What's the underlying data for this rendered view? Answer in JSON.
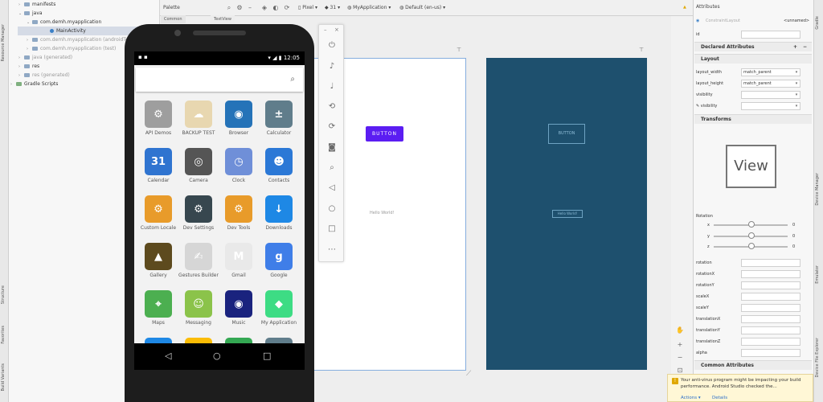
{
  "left_strip": {
    "tabs": [
      "Resource Manager",
      "Structure",
      "Favorites",
      "Build Variants"
    ]
  },
  "project_tree": {
    "items": [
      {
        "label": "manifests",
        "muted": false
      },
      {
        "label": "java",
        "muted": false
      },
      {
        "label": "com.demh.myapplication",
        "muted": false
      },
      {
        "label": "MainActivity",
        "muted": false
      },
      {
        "label": "com.demh.myapplication (androidTest)",
        "muted": true
      },
      {
        "label": "com.demh.myapplication (test)",
        "muted": true
      },
      {
        "label": "java (generated)",
        "muted": true
      },
      {
        "label": "res",
        "muted": false
      },
      {
        "label": "res (generated)",
        "muted": true
      },
      {
        "label": "Gradle Scripts",
        "muted": false
      }
    ]
  },
  "toolbar": {
    "palette_label": "Palette",
    "device": "Pixel",
    "api": "31",
    "app": "MyApplication",
    "locale": "Default (en-us)",
    "tab_common": "Common",
    "tab_textview": "TextView"
  },
  "design": {
    "button_label": "BUTTON",
    "hello_text": "Hello World!",
    "blueprint_button": "BUTTON",
    "blueprint_text": "Hello World!"
  },
  "phone": {
    "time": "12:05",
    "apps": [
      {
        "label": "API Demos",
        "icon": "gear-folder-icon",
        "color": "#9e9e9e",
        "glyph": "⚙"
      },
      {
        "label": "BACKUP TEST",
        "icon": "sheep-icon",
        "color": "#e8d7b0",
        "glyph": "☁"
      },
      {
        "label": "Browser",
        "icon": "globe-icon",
        "color": "#2573b8",
        "glyph": "◉"
      },
      {
        "label": "Calculator",
        "icon": "calculator-icon",
        "color": "#607d8b",
        "glyph": "±"
      },
      {
        "label": "Calendar",
        "icon": "calendar-icon",
        "color": "#2f74d0",
        "glyph": "31"
      },
      {
        "label": "Camera",
        "icon": "camera-icon",
        "color": "#555555",
        "glyph": "◎"
      },
      {
        "label": "Clock",
        "icon": "clock-icon",
        "color": "#6f8fd8",
        "glyph": "◷"
      },
      {
        "label": "Contacts",
        "icon": "contacts-icon",
        "color": "#2b78d6",
        "glyph": "☻"
      },
      {
        "label": "Custom Locale",
        "icon": "locale-gear-icon",
        "color": "#e89b2a",
        "glyph": "⚙"
      },
      {
        "label": "Dev Settings",
        "icon": "dev-settings-icon",
        "color": "#37474f",
        "glyph": "⚙"
      },
      {
        "label": "Dev Tools",
        "icon": "dev-tools-icon",
        "color": "#e89b2a",
        "glyph": "⚙"
      },
      {
        "label": "Downloads",
        "icon": "download-icon",
        "color": "#1e88e5",
        "glyph": "↓"
      },
      {
        "label": "Gallery",
        "icon": "gallery-icon",
        "color": "#5d4a1e",
        "glyph": "▲"
      },
      {
        "label": "Gestures Builder",
        "icon": "gestures-icon",
        "color": "#d6d6d6",
        "glyph": "✍"
      },
      {
        "label": "Gmail",
        "icon": "gmail-icon",
        "color": "#e9e9e9",
        "glyph": "M"
      },
      {
        "label": "Google",
        "icon": "google-icon",
        "color": "#3f7ee8",
        "glyph": "g"
      },
      {
        "label": "Maps",
        "icon": "maps-icon",
        "color": "#4caf50",
        "glyph": "⌖"
      },
      {
        "label": "Messaging",
        "icon": "messaging-icon",
        "color": "#8bc34a",
        "glyph": "☺"
      },
      {
        "label": "Music",
        "icon": "music-icon",
        "color": "#1a237e",
        "glyph": "◉"
      },
      {
        "label": "My Application",
        "icon": "android-icon",
        "color": "#3ddc84",
        "glyph": "◆"
      },
      {
        "label": "",
        "icon": "phone-icon",
        "color": "#1e88e5",
        "glyph": "✆"
      },
      {
        "label": "",
        "icon": "photos-icon",
        "color": "#fbbc05",
        "glyph": "✿"
      },
      {
        "label": "",
        "icon": "play-store-icon",
        "color": "#34a853",
        "glyph": "▶"
      },
      {
        "label": "",
        "icon": "settings-icon",
        "color": "#607d8b",
        "glyph": "⚙"
      }
    ]
  },
  "attributes": {
    "title": "Attributes",
    "component": "ConstraintLayout",
    "component_tag": "<unnamed>",
    "id_label": "id",
    "declared": "Declared Attributes",
    "layout_section": "Layout",
    "layout_width_label": "layout_width",
    "layout_width_value": "match_parent",
    "layout_height_label": "layout_height",
    "layout_height_value": "match_parent",
    "visibility_label": "visibility",
    "visibility2_label": "visibility",
    "transforms_section": "Transforms",
    "view_label": "View",
    "rotation_label": "Rotation",
    "axis_x": "x",
    "axis_y": "y",
    "axis_z": "z",
    "slider_zero": "0",
    "rotation_row": "rotation",
    "rotationX": "rotationX",
    "rotationY": "rotationY",
    "scaleX": "scaleX",
    "scaleY": "scaleY",
    "translationX": "translationX",
    "translationY": "translationY",
    "translationZ": "translationZ",
    "alpha": "alpha",
    "common_section": "Common Attributes"
  },
  "notification": {
    "text": "Your anti-virus program might be impacting your build performance. Android Studio checked the...",
    "actions": "Actions ▾",
    "details": "Details"
  },
  "right_strip": {
    "tabs": [
      "Gradle",
      "Device Manager",
      "Emulator",
      "Device File Explorer"
    ]
  }
}
